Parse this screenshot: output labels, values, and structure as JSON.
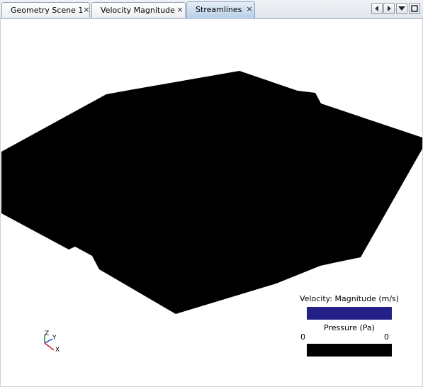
{
  "tabs": [
    {
      "label": "Geometry Scene 1",
      "close": "×"
    },
    {
      "label": "Velocity Magnitude",
      "close": "×"
    },
    {
      "label": "Streamlines",
      "close": "×"
    }
  ],
  "active_tab": "Streamlines",
  "tab_nav": {
    "prev_icon": "chevron-left-icon",
    "next_icon": "chevron-right-icon",
    "menu_icon": "chevron-down-icon",
    "maximize_icon": "maximize-icon"
  },
  "legend": {
    "velocity_title": "Velocity: Magnitude (m/s)",
    "velocity_color": "#232188",
    "pressure_title": "Pressure (Pa)",
    "pressure_min": "0",
    "pressure_max": "0",
    "pressure_color": "#000000"
  },
  "axes": {
    "z": "Z",
    "y": "Y",
    "x": "X",
    "z_color": "#2a8a2a",
    "y_color": "#1f3fcf",
    "x_color": "#d22020"
  }
}
